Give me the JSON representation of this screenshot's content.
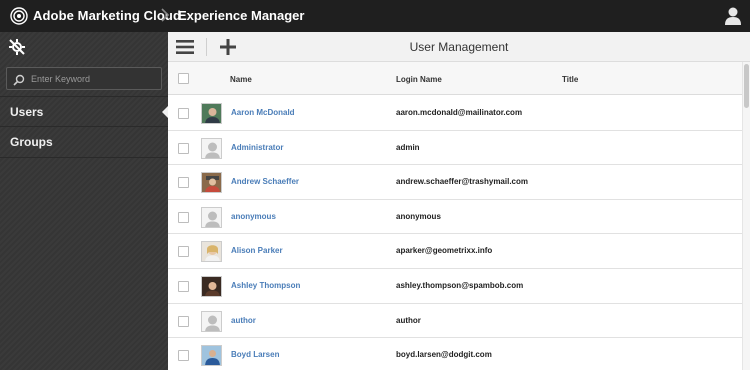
{
  "topbar": {
    "brand": "Adobe Marketing Cloud",
    "separator": "›",
    "product": "Experience Manager",
    "icons": {
      "logo": "adobe-cloud-logo-icon",
      "user": "user-profile-icon"
    }
  },
  "sidebar": {
    "rail_icon": "rail-toggle-icon",
    "search": {
      "placeholder": "Enter Keyword",
      "value": ""
    },
    "items": [
      {
        "label": "Users",
        "active": true
      },
      {
        "label": "Groups",
        "active": false
      }
    ]
  },
  "toolbar": {
    "title": "User Management",
    "icons": {
      "menu": "hamburger-menu-icon",
      "add": "plus-icon"
    }
  },
  "table": {
    "columns": [
      "Name",
      "Login Name",
      "Title"
    ],
    "rows": [
      {
        "name": "Aaron McDonald",
        "login": "aaron.mcdonald@mailinator.com",
        "title": "",
        "avatar": "photo"
      },
      {
        "name": "Administrator",
        "login": "admin",
        "title": "",
        "avatar": "placeholder"
      },
      {
        "name": "Andrew Schaeffer",
        "login": "andrew.schaeffer@trashymail.com",
        "title": "",
        "avatar": "photo"
      },
      {
        "name": "anonymous",
        "login": "anonymous",
        "title": "",
        "avatar": "placeholder"
      },
      {
        "name": "Alison Parker",
        "login": "aparker@geometrixx.info",
        "title": "",
        "avatar": "photo"
      },
      {
        "name": "Ashley Thompson",
        "login": "ashley.thompson@spambob.com",
        "title": "",
        "avatar": "photo"
      },
      {
        "name": "author",
        "login": "author",
        "title": "",
        "avatar": "placeholder"
      },
      {
        "name": "Boyd Larsen",
        "login": "boyd.larsen@dodgit.com",
        "title": "",
        "avatar": "photo"
      }
    ]
  },
  "colors": {
    "topbar": "#1f1f1f",
    "sidebar": "#3a3a3a",
    "link": "#4a7db8",
    "toolbar": "#f2f2f2"
  }
}
